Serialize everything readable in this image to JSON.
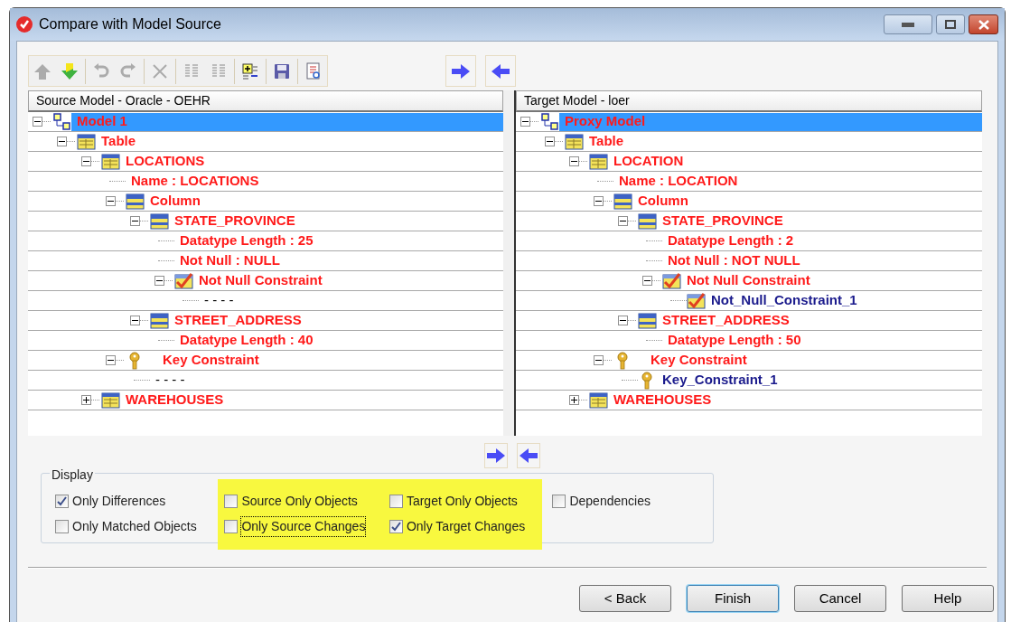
{
  "window": {
    "title": "Compare with Model Source"
  },
  "toolbar": [
    {
      "kind": "up",
      "disabled": true
    },
    {
      "kind": "down",
      "disabled": false
    },
    {
      "kind": "separator"
    },
    {
      "kind": "undo",
      "disabled": true
    },
    {
      "kind": "redo",
      "disabled": true
    },
    {
      "kind": "separator"
    },
    {
      "kind": "delete",
      "disabled": true
    },
    {
      "kind": "separator"
    },
    {
      "kind": "columns",
      "disabled": true
    },
    {
      "kind": "columns",
      "disabled": true
    },
    {
      "kind": "separator"
    },
    {
      "kind": "expand",
      "disabled": false
    },
    {
      "kind": "separator"
    },
    {
      "kind": "save",
      "disabled": false
    },
    {
      "kind": "separator"
    },
    {
      "kind": "report",
      "disabled": false
    }
  ],
  "source": {
    "header": "Source Model - Oracle - OEHR",
    "tree": [
      {
        "kind": "model",
        "text": "Model 1",
        "differs": true,
        "selected": true,
        "expanded": true,
        "children": [
          {
            "kind": "folder",
            "text": "Table",
            "differs": true,
            "selected": false,
            "expanded": true,
            "children": [
              {
                "kind": "table",
                "text": "LOCATIONS",
                "differs": true,
                "selected": false,
                "expanded": true,
                "children": [
                  {
                    "kind": "property",
                    "text": "Name : LOCATIONS",
                    "differs": true,
                    "selected": false
                  },
                  {
                    "kind": "column",
                    "text": "Column",
                    "differs": true,
                    "selected": false,
                    "expanded": true,
                    "children": [
                      {
                        "kind": "column",
                        "text": "STATE_PROVINCE",
                        "differs": true,
                        "selected": false,
                        "expanded": true,
                        "children": [
                          {
                            "kind": "property",
                            "text": "Datatype Length : 25",
                            "differs": true,
                            "selected": false
                          },
                          {
                            "kind": "property",
                            "text": "Not Null : NULL",
                            "differs": true,
                            "selected": false
                          },
                          {
                            "kind": "constraint",
                            "text": "Not Null Constraint",
                            "differs": true,
                            "selected": false,
                            "expanded": true,
                            "children": [
                              {
                                "kind": "placeholder",
                                "text": "- - - -",
                                "selected": false
                              }
                            ]
                          }
                        ]
                      },
                      {
                        "kind": "column",
                        "text": "STREET_ADDRESS",
                        "differs": true,
                        "selected": false,
                        "expanded": true,
                        "children": [
                          {
                            "kind": "property",
                            "text": "Datatype Length : 40",
                            "differs": true,
                            "selected": false
                          }
                        ]
                      }
                    ]
                  },
                  {
                    "kind": "key",
                    "text": "Key Constraint",
                    "differs": true,
                    "selected": false,
                    "expanded": true,
                    "children": [
                      {
                        "kind": "placeholder",
                        "text": "- - - -",
                        "selected": false
                      }
                    ]
                  }
                ]
              },
              {
                "kind": "table",
                "text": "WAREHOUSES",
                "differs": true,
                "selected": false,
                "expanded": false
              }
            ]
          }
        ]
      }
    ]
  },
  "target": {
    "header": "Target Model - loer",
    "tree": [
      {
        "kind": "model",
        "text": "Proxy Model",
        "differs": true,
        "selected": true,
        "expanded": true,
        "children": [
          {
            "kind": "folder",
            "text": "Table",
            "differs": true,
            "selected": false,
            "expanded": true,
            "children": [
              {
                "kind": "table",
                "text": "LOCATION",
                "differs": true,
                "selected": false,
                "expanded": true,
                "children": [
                  {
                    "kind": "property",
                    "text": "Name : LOCATION",
                    "differs": true,
                    "selected": false
                  },
                  {
                    "kind": "column",
                    "text": "Column",
                    "differs": true,
                    "selected": false,
                    "expanded": true,
                    "children": [
                      {
                        "kind": "column",
                        "text": "STATE_PROVINCE",
                        "differs": true,
                        "selected": false,
                        "expanded": true,
                        "children": [
                          {
                            "kind": "property",
                            "text": "Datatype Length : 2",
                            "differs": true,
                            "selected": false
                          },
                          {
                            "kind": "property",
                            "text": "Not Null : NOT NULL",
                            "differs": true,
                            "selected": false
                          },
                          {
                            "kind": "constraint",
                            "text": "Not Null Constraint",
                            "differs": true,
                            "selected": false,
                            "expanded": true,
                            "children": [
                              {
                                "kind": "constraint",
                                "text": "Not_Null_Constraint_1",
                                "differs": false,
                                "selected": false
                              }
                            ]
                          }
                        ]
                      },
                      {
                        "kind": "column",
                        "text": "STREET_ADDRESS",
                        "differs": true,
                        "selected": false,
                        "expanded": true,
                        "children": [
                          {
                            "kind": "property",
                            "text": "Datatype Length : 50",
                            "differs": true,
                            "selected": false
                          }
                        ]
                      }
                    ]
                  },
                  {
                    "kind": "key",
                    "text": "Key Constraint",
                    "differs": true,
                    "selected": false,
                    "expanded": true,
                    "children": [
                      {
                        "kind": "key",
                        "text": "Key_Constraint_1",
                        "differs": false,
                        "selected": false
                      }
                    ]
                  }
                ]
              },
              {
                "kind": "table",
                "text": "WAREHOUSES",
                "differs": true,
                "selected": false,
                "expanded": false
              }
            ]
          }
        ]
      }
    ]
  },
  "display": {
    "title": "Display",
    "options": [
      {
        "label": "Only Differences",
        "checked": true,
        "focused": false
      },
      {
        "label": "Only Matched Objects",
        "checked": false,
        "focused": false
      },
      {
        "label": "Source Only Objects",
        "checked": false,
        "focused": false
      },
      {
        "label": "Only Source Changes",
        "checked": false,
        "focused": true
      },
      {
        "label": "Target Only Objects",
        "checked": false,
        "focused": false
      },
      {
        "label": "Only Target Changes",
        "checked": true,
        "focused": false
      },
      {
        "label": "Dependencies",
        "checked": false,
        "focused": false
      }
    ]
  },
  "buttons": [
    {
      "label": "< Back",
      "default": false
    },
    {
      "label": "Finish",
      "default": true
    },
    {
      "label": "Cancel",
      "default": false
    },
    {
      "label": "Help",
      "default": false
    }
  ]
}
